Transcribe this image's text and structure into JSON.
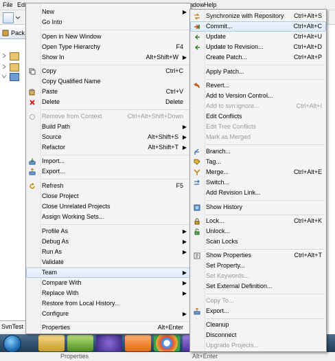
{
  "menubar": {
    "file": "File",
    "edit": "Edi",
    "window": "ndow",
    "help": "Help"
  },
  "left_panel": {
    "tab_label": "Pack",
    "status_tab": "SvnTest"
  },
  "bottom_strip": {
    "properties": "Properties",
    "shortcut": "Alt+Enter"
  },
  "context_menu": {
    "items": [
      {
        "label": "New",
        "shortcut": "",
        "submenu": true,
        "icon": ""
      },
      {
        "label": "Go Into",
        "shortcut": "",
        "submenu": false,
        "icon": ""
      },
      {
        "label": "Open in New Window",
        "shortcut": "",
        "submenu": false,
        "icon": ""
      },
      {
        "label": "Open Type Hierarchy",
        "shortcut": "F4",
        "submenu": false,
        "icon": ""
      },
      {
        "label": "Show In",
        "shortcut": "Alt+Shift+W",
        "submenu": true,
        "icon": ""
      },
      {
        "label": "Copy",
        "shortcut": "Ctrl+C",
        "submenu": false,
        "icon": "copy-icon"
      },
      {
        "label": "Copy Qualified Name",
        "shortcut": "",
        "submenu": false,
        "icon": ""
      },
      {
        "label": "Paste",
        "shortcut": "Ctrl+V",
        "submenu": false,
        "icon": "paste-icon"
      },
      {
        "label": "Delete",
        "shortcut": "Delete",
        "submenu": false,
        "icon": "delete-icon"
      },
      {
        "label": "Remove from Context",
        "shortcut": "Ctrl+Alt+Shift+Down",
        "submenu": false,
        "disabled": true,
        "icon": "remove-context-icon"
      },
      {
        "label": "Build Path",
        "shortcut": "",
        "submenu": true,
        "icon": ""
      },
      {
        "label": "Source",
        "shortcut": "Alt+Shift+S",
        "submenu": true,
        "icon": ""
      },
      {
        "label": "Refactor",
        "shortcut": "Alt+Shift+T",
        "submenu": true,
        "icon": ""
      },
      {
        "label": "Import...",
        "shortcut": "",
        "submenu": false,
        "icon": "import-icon"
      },
      {
        "label": "Export...",
        "shortcut": "",
        "submenu": false,
        "icon": "export-icon"
      },
      {
        "label": "Refresh",
        "shortcut": "F5",
        "submenu": false,
        "icon": "refresh-icon"
      },
      {
        "label": "Close Project",
        "shortcut": "",
        "submenu": false,
        "icon": ""
      },
      {
        "label": "Close Unrelated Projects",
        "shortcut": "",
        "submenu": false,
        "icon": ""
      },
      {
        "label": "Assign Working Sets...",
        "shortcut": "",
        "submenu": false,
        "icon": ""
      },
      {
        "label": "Profile As",
        "shortcut": "",
        "submenu": true,
        "icon": ""
      },
      {
        "label": "Debug As",
        "shortcut": "",
        "submenu": true,
        "icon": ""
      },
      {
        "label": "Run As",
        "shortcut": "",
        "submenu": true,
        "icon": ""
      },
      {
        "label": "Validate",
        "shortcut": "",
        "submenu": false,
        "icon": ""
      },
      {
        "label": "Team",
        "shortcut": "",
        "submenu": true,
        "highlighted": true,
        "icon": ""
      },
      {
        "label": "Compare With",
        "shortcut": "",
        "submenu": true,
        "icon": ""
      },
      {
        "label": "Replace With",
        "shortcut": "",
        "submenu": true,
        "icon": ""
      },
      {
        "label": "Restore from Local History...",
        "shortcut": "",
        "submenu": false,
        "icon": ""
      },
      {
        "label": "Configure",
        "shortcut": "",
        "submenu": true,
        "icon": ""
      },
      {
        "label": "Properties",
        "shortcut": "Alt+Enter",
        "submenu": false,
        "icon": ""
      }
    ]
  },
  "team_menu": {
    "items": [
      {
        "label": "Synchronize with Repository",
        "shortcut": "Ctrl+Alt+S",
        "icon": "synchronize-icon"
      },
      {
        "label": "Commit...",
        "shortcut": "Ctrl+Alt+C",
        "highlighted": true,
        "icon": "commit-icon"
      },
      {
        "label": "Update",
        "shortcut": "Ctrl+Alt+U",
        "icon": "update-icon"
      },
      {
        "label": "Update to Revision...",
        "shortcut": "Ctrl+Alt+D",
        "icon": "update-revision-icon"
      },
      {
        "label": "Create Patch...",
        "shortcut": "Ctrl+Alt+P",
        "icon": ""
      },
      {
        "label": "Apply Patch...",
        "shortcut": "",
        "icon": ""
      },
      {
        "label": "Revert...",
        "shortcut": "",
        "icon": "revert-icon"
      },
      {
        "label": "Add to Version Control...",
        "shortcut": "",
        "icon": ""
      },
      {
        "label": "Add to svn:ignore...",
        "shortcut": "Ctrl+Alt+I",
        "disabled": true,
        "icon": ""
      },
      {
        "label": "Edit Conflicts",
        "shortcut": "",
        "icon": ""
      },
      {
        "label": "Edit Tree Conflicts",
        "shortcut": "",
        "disabled": true,
        "icon": ""
      },
      {
        "label": "Mark as Merged",
        "shortcut": "",
        "disabled": true,
        "icon": ""
      },
      {
        "label": "Branch...",
        "shortcut": "",
        "icon": "branch-icon"
      },
      {
        "label": "Tag...",
        "shortcut": "",
        "icon": "tag-icon"
      },
      {
        "label": "Merge...",
        "shortcut": "Ctrl+Alt+E",
        "icon": "merge-icon"
      },
      {
        "label": "Switch...",
        "shortcut": "",
        "icon": "switch-icon"
      },
      {
        "label": "Add Revision Link...",
        "shortcut": "",
        "icon": ""
      },
      {
        "label": "Show History",
        "shortcut": "",
        "icon": "history-icon"
      },
      {
        "label": "Lock...",
        "shortcut": "Ctrl+Alt+K",
        "icon": "lock-icon"
      },
      {
        "label": "Unlock...",
        "shortcut": "",
        "icon": "unlock-icon"
      },
      {
        "label": "Scan Locks",
        "shortcut": "",
        "icon": ""
      },
      {
        "label": "Show Properties",
        "shortcut": "Ctrl+Alt+T",
        "icon": "properties-icon"
      },
      {
        "label": "Set Property...",
        "shortcut": "",
        "icon": ""
      },
      {
        "label": "Set Keywords...",
        "shortcut": "",
        "disabled": true,
        "icon": ""
      },
      {
        "label": "Set External Definition...",
        "shortcut": "",
        "icon": ""
      },
      {
        "label": "Copy To...",
        "shortcut": "",
        "disabled": true,
        "icon": ""
      },
      {
        "label": "Export...",
        "shortcut": "",
        "icon": "export-icon"
      },
      {
        "label": "Cleanup",
        "shortcut": "",
        "icon": ""
      },
      {
        "label": "Disconnect",
        "shortcut": "",
        "icon": ""
      },
      {
        "label": "Upgrade Projects...",
        "shortcut": "",
        "disabled": true,
        "icon": ""
      }
    ]
  },
  "taskbar": {
    "apps": [
      "file-explorer-icon",
      "green-app-icon",
      "eclipse-icon",
      "settings-app-icon",
      "chrome-icon",
      "purple-app-icon"
    ]
  },
  "colors": {
    "highlight": "#dcebfc",
    "highlight_border": "#a8cbef",
    "disabled_text": "#9a9a9a",
    "taskbar": "#2a4a6a"
  }
}
